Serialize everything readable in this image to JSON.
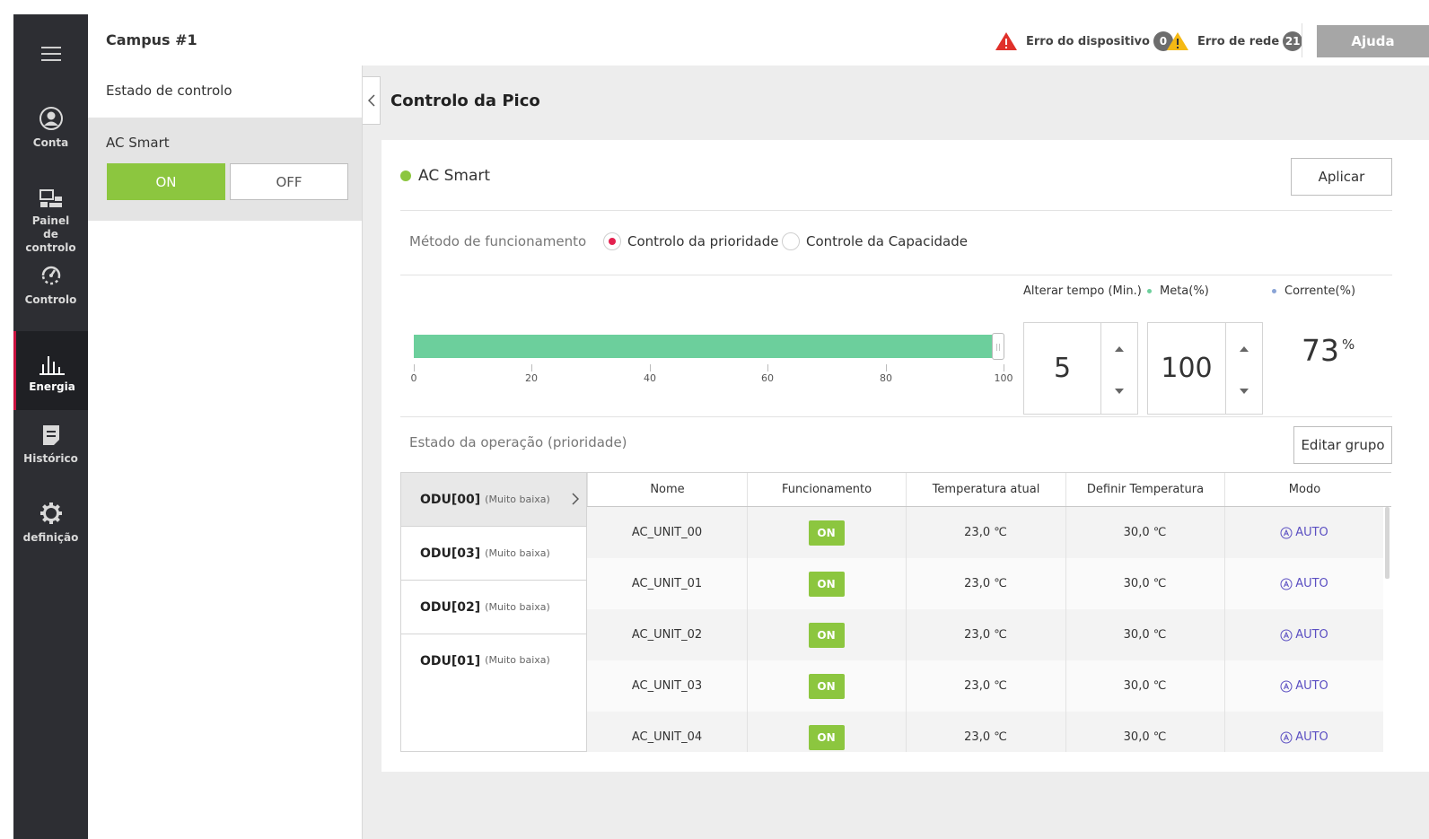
{
  "header": {
    "campus": "Campus #1",
    "device_error_label": "Erro do dispositivo",
    "device_error_count": "0",
    "network_error_label": "Erro de rede",
    "network_error_count": "21",
    "help_label": "Ajuda"
  },
  "sidebar": {
    "items": [
      {
        "label": "Conta",
        "icon": "user-icon"
      },
      {
        "label": "Painel de controlo",
        "icon": "dashboard-icon"
      },
      {
        "label": "Controlo",
        "icon": "control-icon"
      },
      {
        "label": "Energia",
        "icon": "energy-chart-icon",
        "active": true
      },
      {
        "label": "Histórico",
        "icon": "history-icon"
      },
      {
        "label": "definição",
        "icon": "gear-icon"
      }
    ]
  },
  "left_panel": {
    "title": "Estado de controlo",
    "group_label": "AC Smart",
    "on_label": "ON",
    "off_label": "OFF",
    "selected": "ON"
  },
  "main": {
    "title": "Controlo da Pico",
    "section_title": "AC Smart",
    "apply_label": "Aplicar",
    "method_label": "Método de funcionamento",
    "methods": [
      "Controlo da prioridade",
      "Controle da Capacidade"
    ],
    "selected_method": "Controlo da prioridade",
    "legend": {
      "change_time": "Alterar tempo (Min.)",
      "target": "Meta(%)",
      "current": "Corrente(%)"
    },
    "slider": {
      "value": 100,
      "min": 0,
      "max": 100,
      "ticks": [
        "0",
        "20",
        "40",
        "60",
        "80",
        "100"
      ]
    },
    "change_time_value": "5",
    "target_value": "100",
    "current_value": "73",
    "current_unit": "%",
    "operation_title": "Estado da operação (prioridade)",
    "edit_group_label": "Editar grupo",
    "odu_groups": [
      {
        "name": "ODU[00]",
        "level": "(Muito baixa)",
        "active": true
      },
      {
        "name": "ODU[03]",
        "level": "(Muito baixa)"
      },
      {
        "name": "ODU[02]",
        "level": "(Muito baixa)"
      },
      {
        "name": "ODU[01]",
        "level": "(Muito baixa)"
      }
    ],
    "table": {
      "columns": [
        "Nome",
        "Funcionamento",
        "Temperatura atual",
        "Definir Temperatura",
        "Modo"
      ],
      "rows": [
        {
          "name": "AC_UNIT_00",
          "status": "ON",
          "current_temp": "23,0 ℃",
          "set_temp": "30,0 ℃",
          "mode": "AUTO"
        },
        {
          "name": "AC_UNIT_01",
          "status": "ON",
          "current_temp": "23,0 ℃",
          "set_temp": "30,0 ℃",
          "mode": "AUTO"
        },
        {
          "name": "AC_UNIT_02",
          "status": "ON",
          "current_temp": "23,0 ℃",
          "set_temp": "30,0 ℃",
          "mode": "AUTO"
        },
        {
          "name": "AC_UNIT_03",
          "status": "ON",
          "current_temp": "23,0 ℃",
          "set_temp": "30,0 ℃",
          "mode": "AUTO"
        },
        {
          "name": "AC_UNIT_04",
          "status": "ON",
          "current_temp": "23,0 ℃",
          "set_temp": "30,0 ℃",
          "mode": "AUTO"
        }
      ]
    }
  },
  "colors": {
    "accent_green": "#8cc63f",
    "slider_green": "#6ccf9c",
    "active_red": "#c8123f",
    "sidebar_bg": "#2d2e33",
    "mode_purple": "#5b4fc2"
  }
}
